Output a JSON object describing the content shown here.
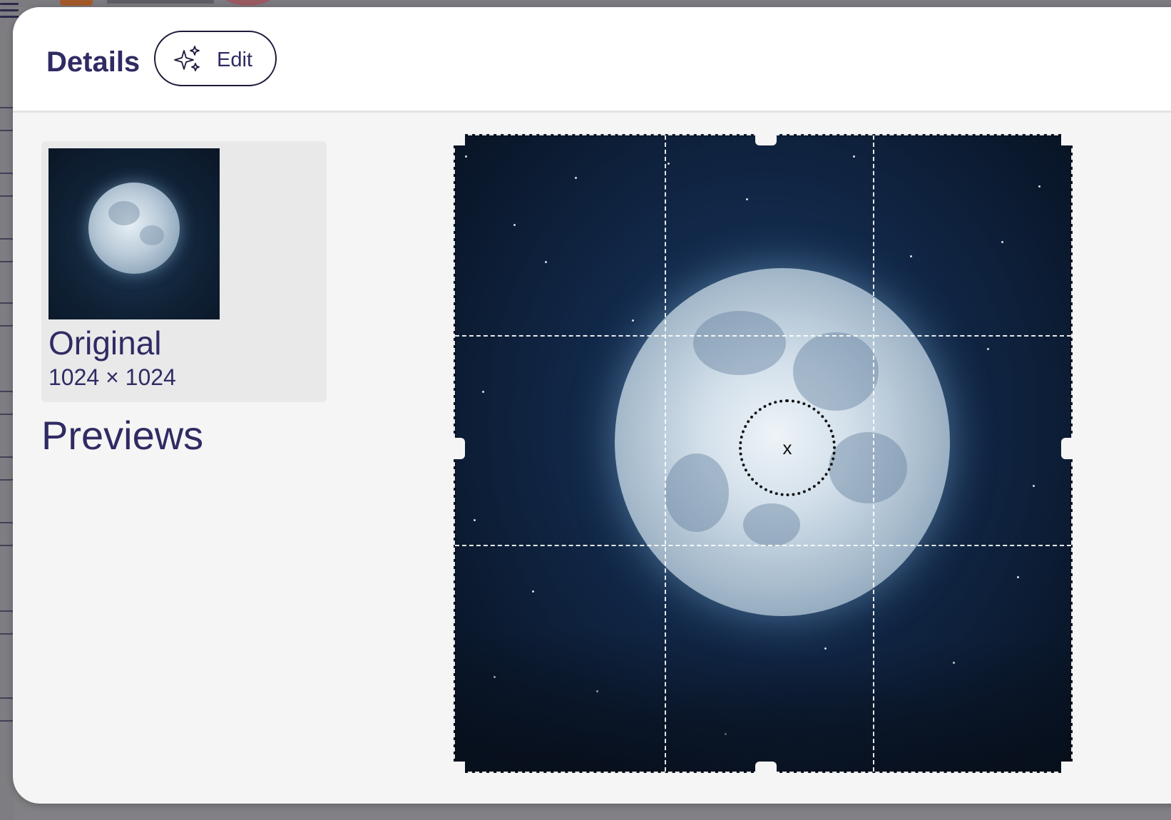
{
  "header": {
    "title": "Details",
    "edit_label": "Edit",
    "edit_icon": "sparkles-icon"
  },
  "original": {
    "label": "Original",
    "dimensions": "1024 × 1024"
  },
  "previews": {
    "heading": "Previews"
  },
  "crop": {
    "focal_point_label": "x"
  },
  "colors": {
    "text_primary": "#2f2b63",
    "modal_background": "#f5f5f5",
    "header_background": "#ffffff",
    "card_background": "#e9e9ea"
  }
}
